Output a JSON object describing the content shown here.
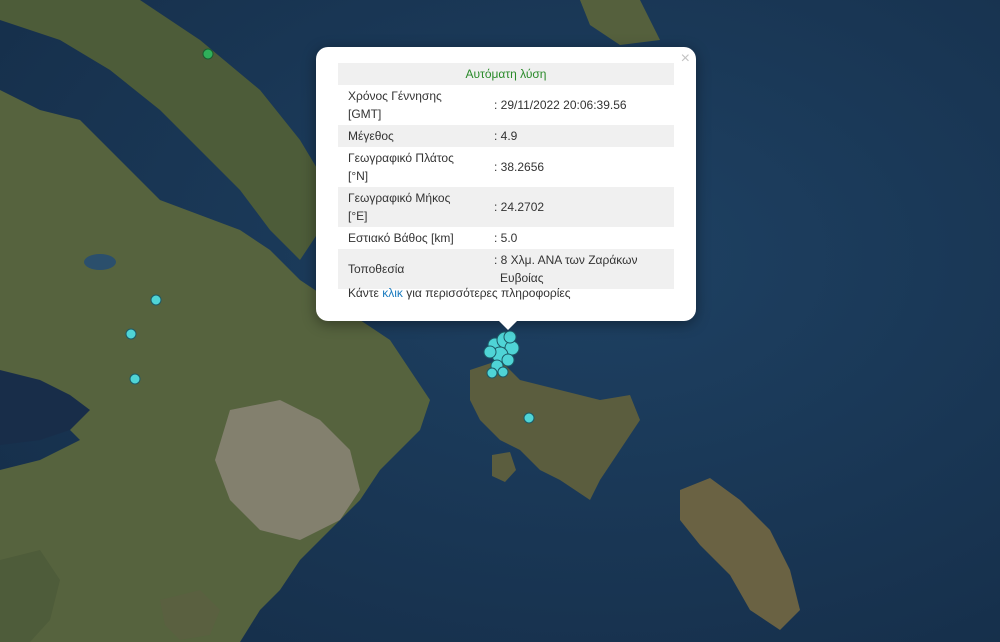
{
  "map": {
    "colors": {
      "sea": "#1b3a5a",
      "land": "#4e5e3b",
      "city": "#8c8578"
    },
    "markers": [
      {
        "kind": "quake-marker",
        "color": "#4fd4d6"
      },
      {
        "kind": "green-marker",
        "color": "#2fb05a"
      }
    ]
  },
  "popup": {
    "close_label": "×",
    "title": "Αυτόματη λύση",
    "rows": [
      {
        "key_line1": "Χρόνος Γέννησης",
        "key_line2": "[GMT]",
        "value": ": 29/11/2022 20:06:39.56"
      },
      {
        "key_line1": "Μέγεθος",
        "value": ": 4.9"
      },
      {
        "key_line1": "Γεωγραφικό Πλάτος",
        "key_line2": "[°N]",
        "value": ": 38.2656"
      },
      {
        "key_line1": "Γεωγραφικό Μήκος",
        "key_line2": "[°E]",
        "value": ": 24.2702"
      },
      {
        "key_line1": "Εστιακό Βάθος [km]",
        "value": ": 5.0"
      },
      {
        "key_line1": "Τοποθεσία",
        "value_line1": ": 8 Χλμ. ΑΝΑ των Ζαράκων",
        "value_line2": "Ευβοίας"
      }
    ],
    "footer": {
      "prefix": "Κάντε",
      "link": "κλικ",
      "suffix": "για περισσότερες πληροφορίες"
    }
  }
}
